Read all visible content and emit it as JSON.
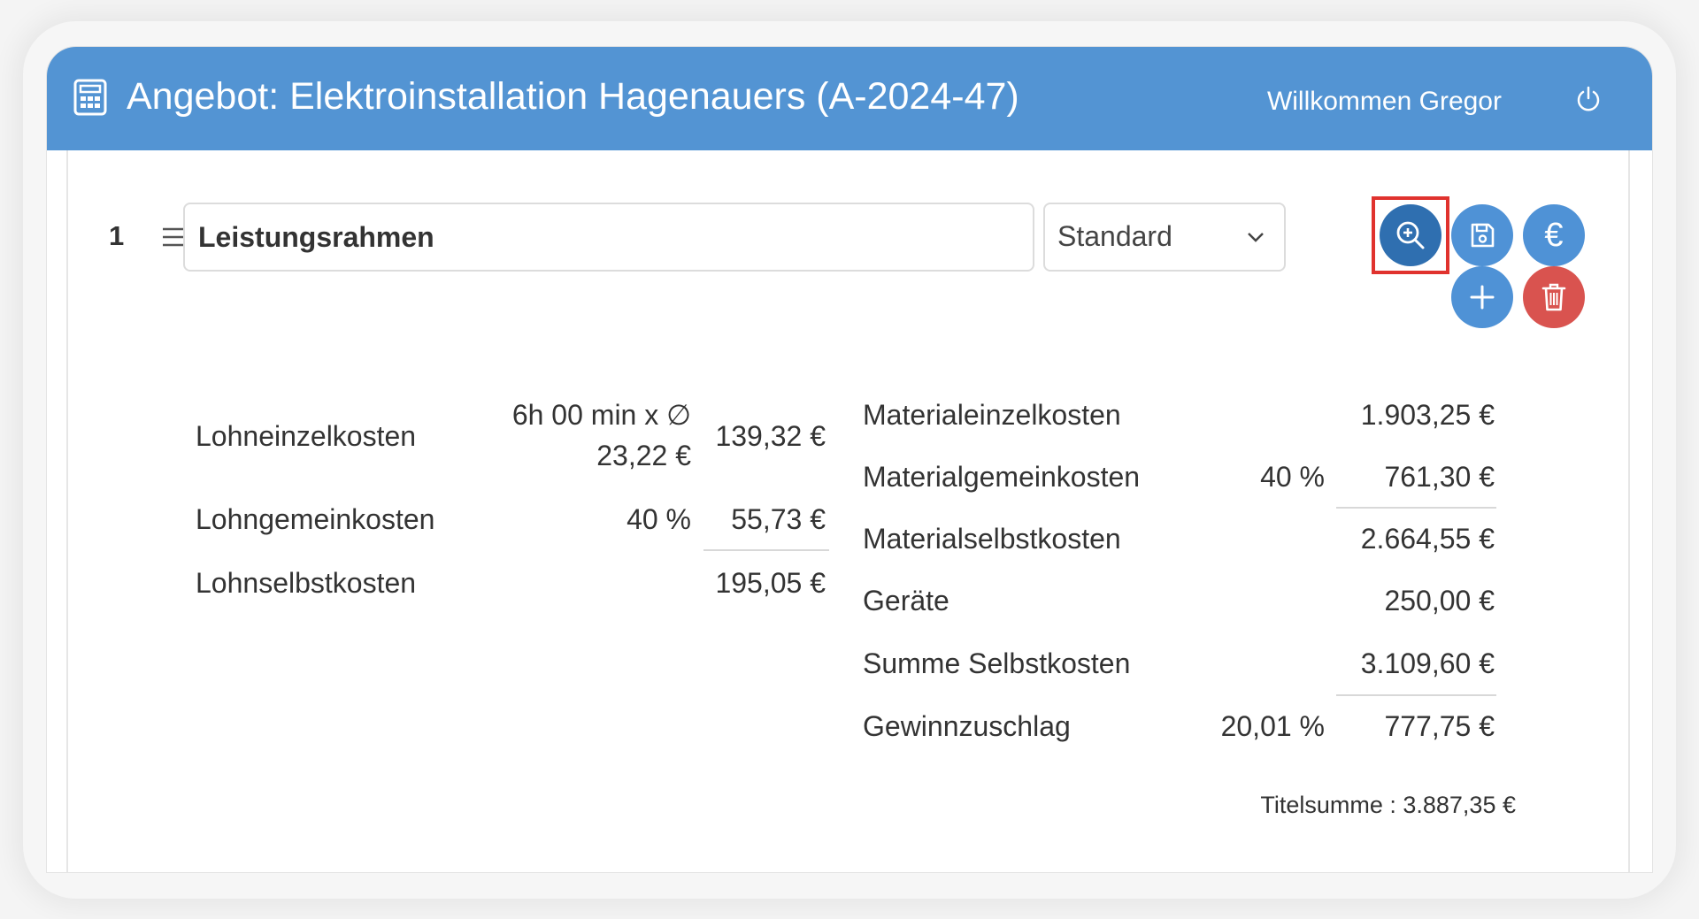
{
  "header": {
    "title": "Angebot: Elektroinstallation Hagenauers (A-2024-47)",
    "welcome": "Willkommen Gregor",
    "icons": [
      "calculator-icon",
      "power-icon"
    ],
    "background_color": "#5394d3"
  },
  "position": {
    "number": "1",
    "title_value": "Leistungsrahmen",
    "type_selected": "Standard"
  },
  "actions": {
    "icons": [
      "zoom-in-icon",
      "save-icon",
      "euro-icon",
      "plus-icon",
      "trash-icon"
    ],
    "euro_symbol": "€",
    "highlighted": "zoom-in-icon",
    "colors": {
      "primary": "#4f92d6",
      "active": "#2f6fb0",
      "danger": "#d9534f",
      "highlight": "#e0322e"
    }
  },
  "labor": {
    "rows": [
      {
        "label": "Lohneinzelkosten",
        "detail_line1": "6h 00 min x ∅",
        "detail_line2": "23,22 €",
        "value": "139,32 €"
      },
      {
        "label": "Lohngemeinkosten",
        "detail": "40 %",
        "value": "55,73 €"
      },
      {
        "label": "Lohnselbstkosten",
        "value": "195,05 €"
      }
    ]
  },
  "material": {
    "rows": [
      {
        "label": "Materialeinzelkosten",
        "value": "1.903,25 €"
      },
      {
        "label": "Materialgemeinkosten",
        "detail": "40 %",
        "value": "761,30 €"
      },
      {
        "label": "Materialselbstkosten",
        "value": "2.664,55 €"
      },
      {
        "label": "Geräte",
        "value": "250,00 €"
      },
      {
        "label": "Summe Selbstkosten",
        "value": "3.109,60 €"
      },
      {
        "label": "Gewinnzuschlag",
        "detail": "20,01 %",
        "value": "777,75 €"
      }
    ]
  },
  "title_sum": "Titelsumme : 3.887,35 €"
}
